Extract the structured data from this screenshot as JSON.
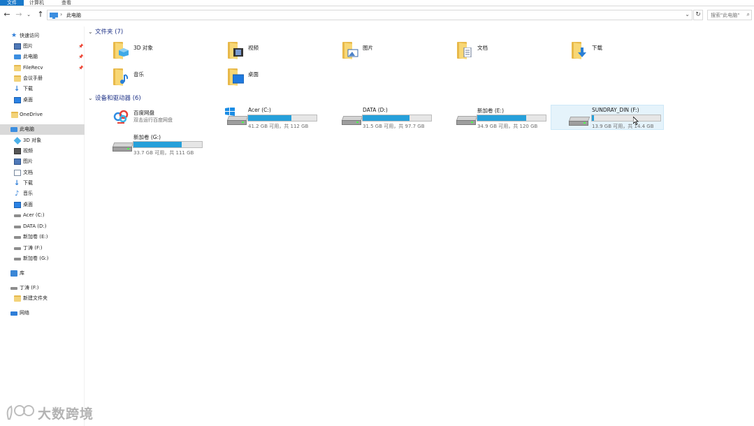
{
  "ribbon": {
    "tabs": [
      "文件",
      "计算机",
      "查看"
    ]
  },
  "address": {
    "path": "此电脑",
    "search_placeholder": "搜索\"此电脑\""
  },
  "nav_pane": {
    "quick_access": "快速访问",
    "items": [
      {
        "label": "图片",
        "icon": "pictures-icon",
        "pinned": true
      },
      {
        "label": "此电脑",
        "icon": "this-pc-icon",
        "pinned": true
      },
      {
        "label": "FileRecv",
        "icon": "folder-icon",
        "pinned": true
      },
      {
        "label": "会议手册",
        "icon": "folder-icon",
        "pinned": false
      },
      {
        "label": "下载",
        "icon": "download-icon",
        "pinned": false
      },
      {
        "label": "桌面",
        "icon": "desktop-icon",
        "pinned": false
      }
    ],
    "onedrive": "OneDrive",
    "this_pc": "此电脑",
    "pc_children": [
      {
        "label": "3D 对象",
        "icon": "3d-objects-icon"
      },
      {
        "label": "视频",
        "icon": "videos-icon"
      },
      {
        "label": "图片",
        "icon": "pictures-icon"
      },
      {
        "label": "文档",
        "icon": "documents-icon"
      },
      {
        "label": "下载",
        "icon": "download-icon"
      },
      {
        "label": "音乐",
        "icon": "music-icon"
      },
      {
        "label": "桌面",
        "icon": "desktop-icon"
      },
      {
        "label": "Acer (C:)",
        "icon": "drive-icon"
      },
      {
        "label": "DATA (D:)",
        "icon": "drive-icon"
      },
      {
        "label": "新加卷 (E:)",
        "icon": "drive-icon"
      },
      {
        "label": "丁涛 (F:)",
        "icon": "drive-icon"
      },
      {
        "label": "新加卷 (G:)",
        "icon": "drive-icon"
      }
    ],
    "libraries": "库",
    "usb_drive": "丁涛 (F:)",
    "usb_child": "新建文件夹",
    "network": "网络"
  },
  "content": {
    "folders_header": "文件夹 (7)",
    "folders": [
      {
        "name": "3D 对象",
        "icon": "3d-objects-icon"
      },
      {
        "name": "视频",
        "icon": "videos-icon"
      },
      {
        "name": "图片",
        "icon": "pictures-icon"
      },
      {
        "name": "文档",
        "icon": "documents-icon"
      },
      {
        "name": "下载",
        "icon": "download-icon"
      },
      {
        "name": "音乐",
        "icon": "music-icon"
      },
      {
        "name": "桌面",
        "icon": "desktop-icon"
      }
    ],
    "devices_header": "设备和驱动器 (6)",
    "baidu": {
      "name": "百度网盘",
      "sub": "双击运行百度网盘"
    },
    "drives": [
      {
        "name": "Acer (C:)",
        "space": "41.2 GB 可用，共 112 GB",
        "used_fraction": 0.63
      },
      {
        "name": "DATA (D:)",
        "space": "31.5 GB 可用，共 97.7 GB",
        "used_fraction": 0.68
      },
      {
        "name": "新加卷 (E:)",
        "space": "34.9 GB 可用，共 120 GB",
        "used_fraction": 0.71
      },
      {
        "name": "SUNDRAY_DIN (F:)",
        "space": "13.9 GB 可用，共 14.4 GB",
        "used_fraction": 0.03
      },
      {
        "name": "新加卷 (G:)",
        "space": "33.7 GB 可用，共 111 GB",
        "used_fraction": 0.7
      }
    ]
  },
  "watermark": {
    "text": "大数跨境"
  },
  "colors": {
    "accent": "#1979ca",
    "bar_fill": "#26a0da",
    "header_text": "#1e3287",
    "hover_bg": "#e5f3fb"
  }
}
